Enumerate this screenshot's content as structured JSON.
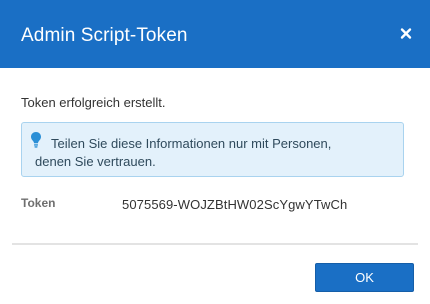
{
  "dialog": {
    "title": "Admin Script-Token",
    "close_icon": "close-icon",
    "header_color": "#1a6fc5"
  },
  "content": {
    "success_message": "Token erfolgreich erstellt.",
    "info": {
      "icon": "lightbulb-icon",
      "line1": "Teilen Sie diese Informationen nur mit Personen,",
      "line2": "denen Sie vertrauen.",
      "background_color": "#e3f1fb",
      "border_color": "#a9d3ef"
    },
    "token": {
      "label": "Token",
      "value": "5075569-WOJZBtHW02ScYgwYTwCh"
    }
  },
  "footer": {
    "ok_label": "OK",
    "accent_color": "#1a6fc5"
  }
}
